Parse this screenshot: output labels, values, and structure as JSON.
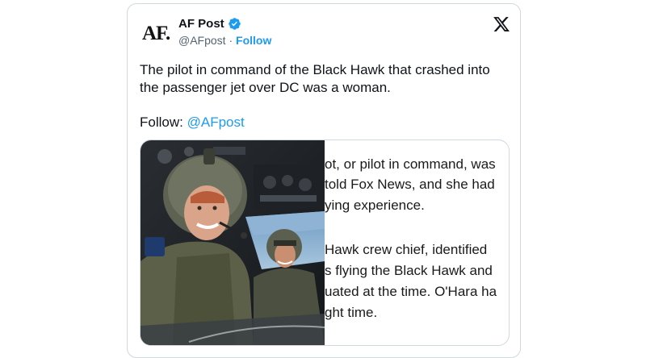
{
  "author": {
    "avatar_text": "AF.",
    "name": "AF Post",
    "handle": "@AFpost",
    "separator": "·",
    "follow_label": "Follow"
  },
  "tweet": {
    "text": "The pilot in command of the Black Hawk that crashed into the passenger jet over DC was a woman.",
    "follow_prefix": "Follow:",
    "follow_mention": "@AFpost"
  },
  "article_excerpt": {
    "lines": [
      "ot, or pilot in command, was",
      " told Fox News, and she had",
      "ying experience.",
      "Hawk crew chief, identified",
      "s flying the Black Hawk and",
      "uated at the time. O'Hara ha",
      "ght time."
    ]
  },
  "icons": {
    "verified": "verified-badge-icon",
    "x_logo": "x-logo-icon"
  },
  "colors": {
    "accent": "#1d9bf0",
    "secondary_text": "#536471",
    "border": "#cfd9de"
  }
}
